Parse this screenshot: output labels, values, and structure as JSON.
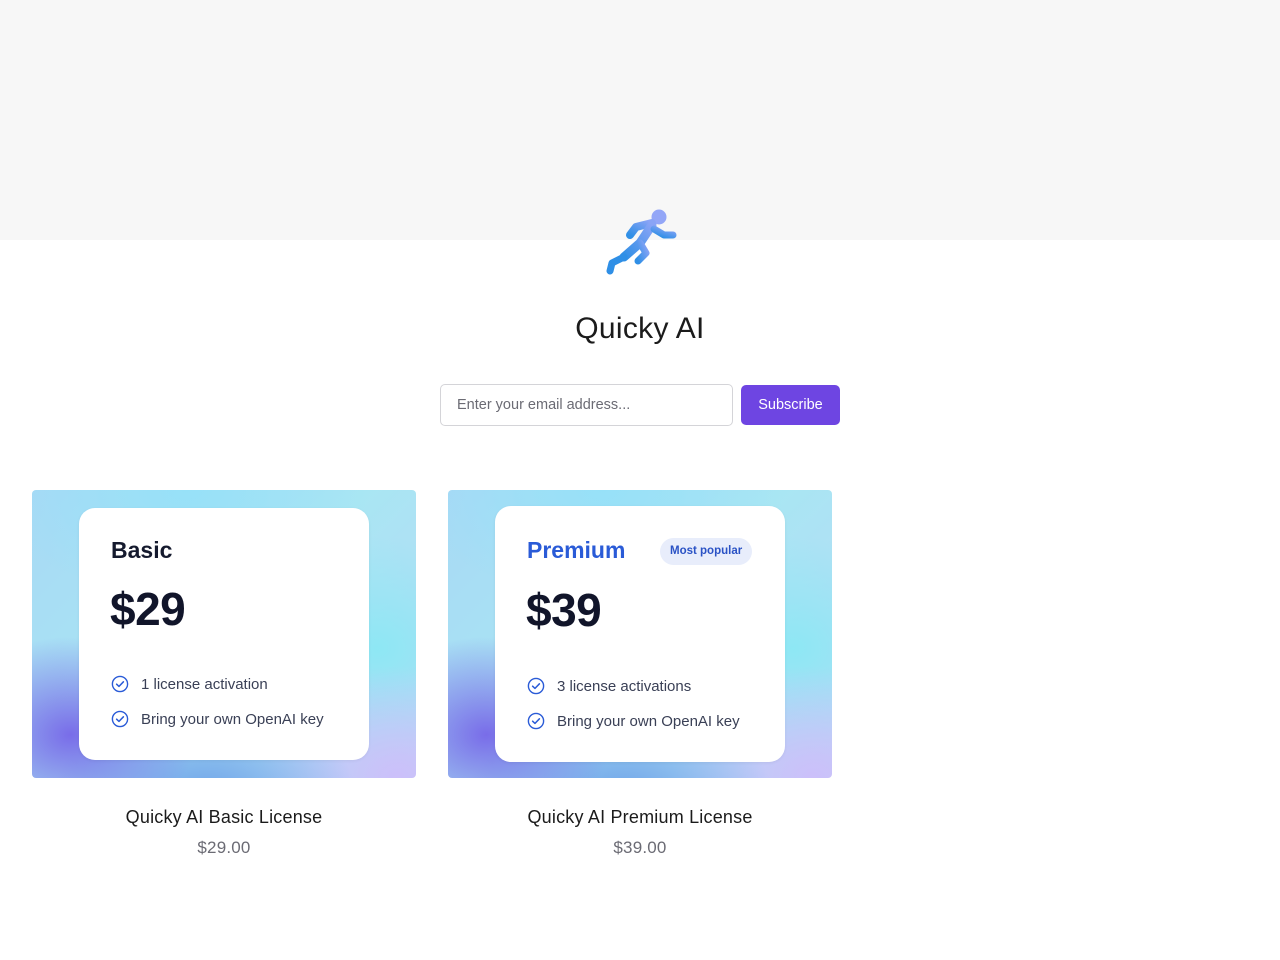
{
  "store": {
    "title": "Quicky AI",
    "logo_icon": "running-figure-icon"
  },
  "subscribe": {
    "placeholder": "Enter your email address...",
    "value": "",
    "button_label": "Subscribe",
    "button_color": "#6e45e2"
  },
  "products": [
    {
      "card": {
        "tier": "Basic",
        "price": "$29",
        "features": [
          "1 license activation",
          "Bring your own OpenAI key"
        ]
      },
      "name": "Quicky AI Basic License",
      "price": "$29.00"
    },
    {
      "card": {
        "tier": "Premium",
        "badge": "Most popular",
        "price": "$39",
        "features": [
          "3 license activations",
          "Bring your own OpenAI key"
        ]
      },
      "name": "Quicky AI Premium License",
      "price": "$39.00"
    }
  ],
  "colors": {
    "accent": "#6e45e2",
    "premium_tier": "#2a5bd7",
    "check_icon": "#2a5bd7"
  }
}
